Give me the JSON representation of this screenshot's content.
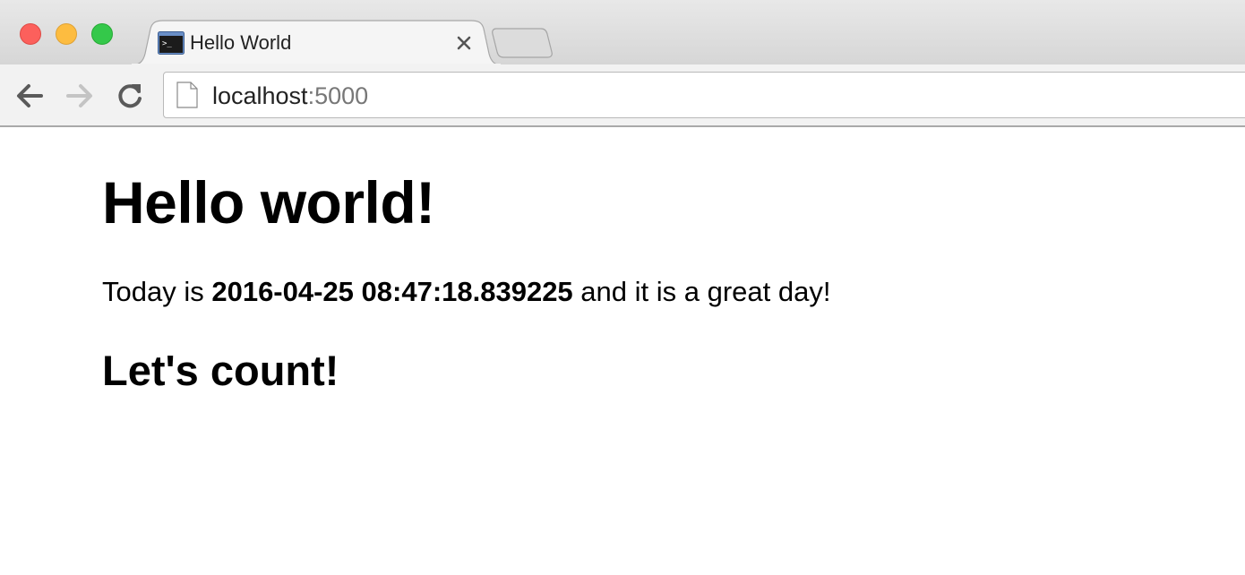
{
  "browser": {
    "tab": {
      "title": "Hello World",
      "favicon": "terminal-icon"
    },
    "address_bar": {
      "host": "localhost",
      "port": ":5000"
    },
    "icons": {
      "back": "back-arrow-icon",
      "forward": "forward-arrow-icon",
      "reload": "reload-icon",
      "page": "page-icon",
      "close_tab": "close-icon"
    },
    "traffic_lights": {
      "close_color": "#fc605c",
      "minimize_color": "#fdbc40",
      "zoom_color": "#34c84a"
    }
  },
  "page": {
    "heading": "Hello world!",
    "intro_prefix": "Today is ",
    "datetime": "2016-04-25 08:47:18.839225",
    "intro_suffix": " and it is a great day!",
    "subheading": "Let's count!"
  }
}
